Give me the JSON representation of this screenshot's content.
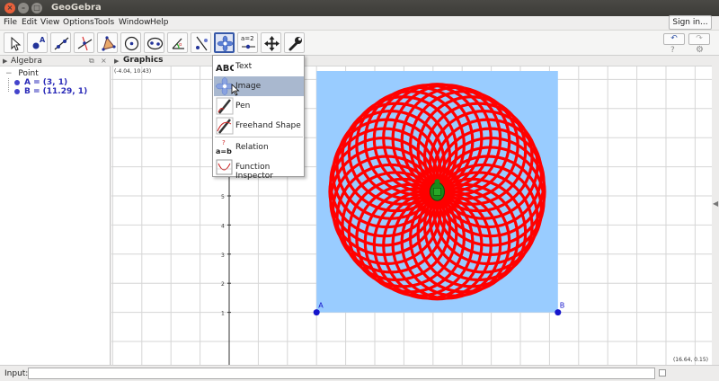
{
  "window": {
    "title": "GeoGebra"
  },
  "menu": [
    "File",
    "Edit",
    "View",
    "Options",
    "Tools",
    "Window",
    "Help"
  ],
  "signin_label": "Sign in...",
  "toolbar": {
    "tools": [
      "move-tool",
      "point-tool",
      "line-tool",
      "perpendicular-tool",
      "polygon-tool",
      "circle-tool",
      "ellipse-tool",
      "angle-tool",
      "reflect-tool",
      "text-image-tool",
      "slider-tool",
      "move-view-tool",
      "wrench-tool"
    ],
    "slider_label": "a=2",
    "undo_label": "↶",
    "redo_label": "↷",
    "help_label": "?",
    "settings_label": "⚙"
  },
  "algebra": {
    "title": "Algebra",
    "group": "Point",
    "objects": [
      {
        "label": "A = (3, 1)"
      },
      {
        "label": "B = (11.29, 1)"
      }
    ]
  },
  "graphics": {
    "title": "Graphics",
    "corner_top_left": "(-4.04, 10.43)",
    "corner_bottom_right": "(16.64, 0.15)",
    "y_tick_labels": [
      "1",
      "2",
      "3",
      "4",
      "5",
      "6"
    ],
    "point_A": {
      "label": "A",
      "x": 3,
      "y": 1
    },
    "point_B": {
      "label": "B",
      "x": 11.29,
      "y": 1
    },
    "image_color": "#99ccff",
    "curve_color": "#ff0000"
  },
  "dropdown": {
    "items": [
      {
        "label": "Text",
        "icon": "text-icon"
      },
      {
        "label": "Image",
        "icon": "image-icon"
      },
      {
        "label": "Pen",
        "icon": "pen-icon"
      },
      {
        "label": "Freehand Shape",
        "icon": "freehand-icon"
      },
      {
        "label": "Relation",
        "icon": "relation-icon"
      },
      {
        "label": "Function Inspector",
        "icon": "function-inspector-icon"
      }
    ]
  },
  "input_label": "Input:"
}
